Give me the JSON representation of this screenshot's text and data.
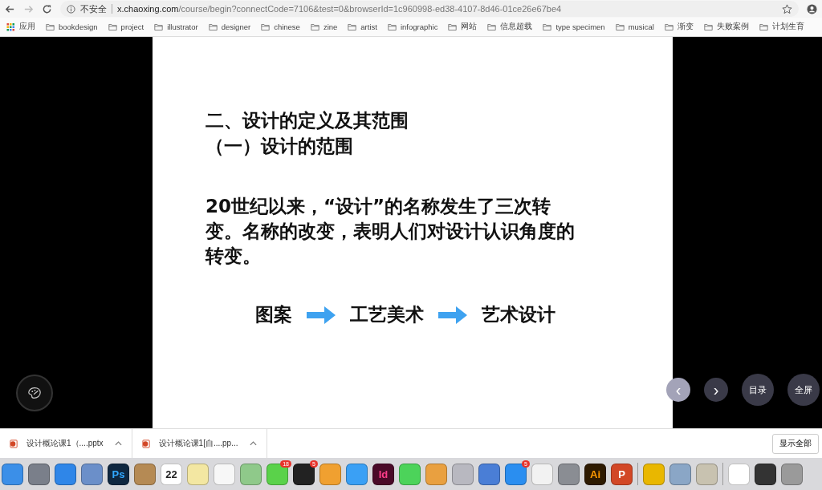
{
  "browser": {
    "security": "不安全",
    "url_host": "x.chaoxing.com",
    "url_path": "/course/begin?connectCode=7106&test=0&browserId=1c960998-ed38-4107-8d46-01ce26e67be4"
  },
  "bookmarks": [
    {
      "kind": "apps",
      "label": "应用"
    },
    {
      "kind": "folder",
      "label": "bookdesign"
    },
    {
      "kind": "folder",
      "label": "project"
    },
    {
      "kind": "folder",
      "label": "illustrator"
    },
    {
      "kind": "folder",
      "label": "designer"
    },
    {
      "kind": "folder",
      "label": "chinese"
    },
    {
      "kind": "folder",
      "label": "zine"
    },
    {
      "kind": "folder",
      "label": "artist"
    },
    {
      "kind": "folder",
      "label": "infographic"
    },
    {
      "kind": "folder",
      "label": "网站"
    },
    {
      "kind": "folder",
      "label": "信息超载"
    },
    {
      "kind": "folder",
      "label": "type specimen"
    },
    {
      "kind": "folder",
      "label": "musical"
    },
    {
      "kind": "folder",
      "label": "渐变"
    },
    {
      "kind": "folder",
      "label": "失败案例"
    },
    {
      "kind": "folder",
      "label": "计划生育"
    }
  ],
  "slide": {
    "title_lines": [
      "二、设计的定义及其范围",
      "（一）设计的范围"
    ],
    "body": "20世纪以来，“设计”的名称发生了三次转变。名称的改变，表明人们对设计认识角度的转变。",
    "flow": [
      "图案",
      "工艺美术",
      "艺术设计"
    ]
  },
  "player": {
    "prev": "‹",
    "next": "›",
    "buttons": [
      "目录",
      "全屏"
    ]
  },
  "downloads": {
    "files": [
      "设计概论课1（....pptx",
      "设计概论课1[自....pp..."
    ],
    "show_all": "显示全部"
  },
  "dock": [
    {
      "kind": "finder"
    },
    {
      "kind": "rocket"
    },
    {
      "kind": "compass"
    },
    {
      "kind": "stamp"
    },
    {
      "kind": "ps",
      "label": "Ps"
    },
    {
      "kind": "book"
    },
    {
      "kind": "calendar",
      "label": "22"
    },
    {
      "kind": "notes"
    },
    {
      "kind": "list"
    },
    {
      "kind": "map"
    },
    {
      "kind": "chat",
      "badge": "18"
    },
    {
      "kind": "penguin",
      "badge": "5"
    },
    {
      "kind": "photos"
    },
    {
      "kind": "bubble"
    },
    {
      "kind": "id",
      "label": "Id"
    },
    {
      "kind": "facetime"
    },
    {
      "kind": "pen"
    },
    {
      "kind": "nosign"
    },
    {
      "kind": "keynote"
    },
    {
      "kind": "store",
      "badge": "5"
    },
    {
      "kind": "chart"
    },
    {
      "kind": "gear"
    },
    {
      "kind": "ai",
      "label": "Ai"
    },
    {
      "kind": "ppt",
      "label": "P"
    },
    {
      "kind": "sep"
    },
    {
      "kind": "chrome"
    },
    {
      "kind": "preview"
    },
    {
      "kind": "pen2"
    },
    {
      "kind": "sep"
    },
    {
      "kind": "chart2"
    },
    {
      "kind": "screen"
    },
    {
      "kind": "trash"
    }
  ]
}
